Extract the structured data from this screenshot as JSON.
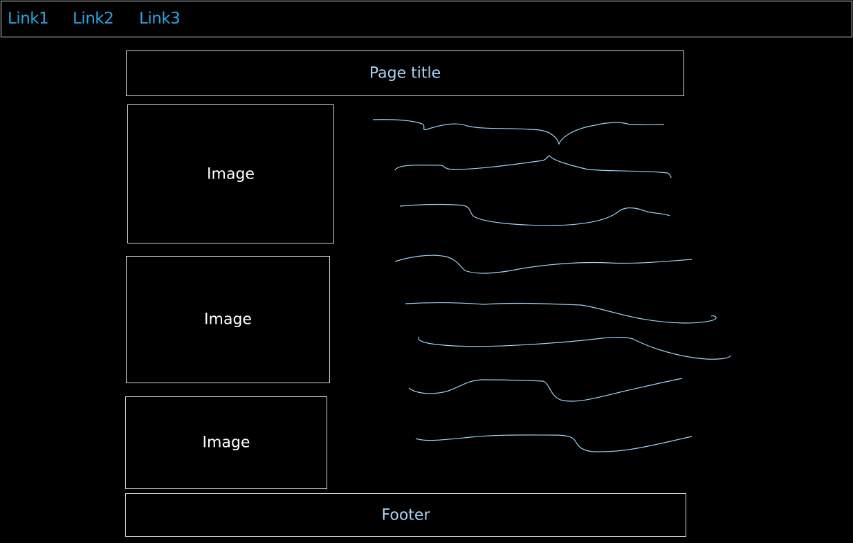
{
  "nav": {
    "links": [
      "Link1",
      "Link2",
      "Link3"
    ],
    "link_color": "#2ba3e0"
  },
  "header": {
    "title": "Page title"
  },
  "content": {
    "images": [
      {
        "label": "Image"
      },
      {
        "label": "Image"
      },
      {
        "label": "Image"
      }
    ],
    "text_placeholder_lines": 8
  },
  "footer": {
    "label": "Footer"
  },
  "colors": {
    "background": "#000000",
    "border": "#d8d8d8",
    "accent_text": "#a9d2f2",
    "squiggle": "#9fd4f6"
  }
}
